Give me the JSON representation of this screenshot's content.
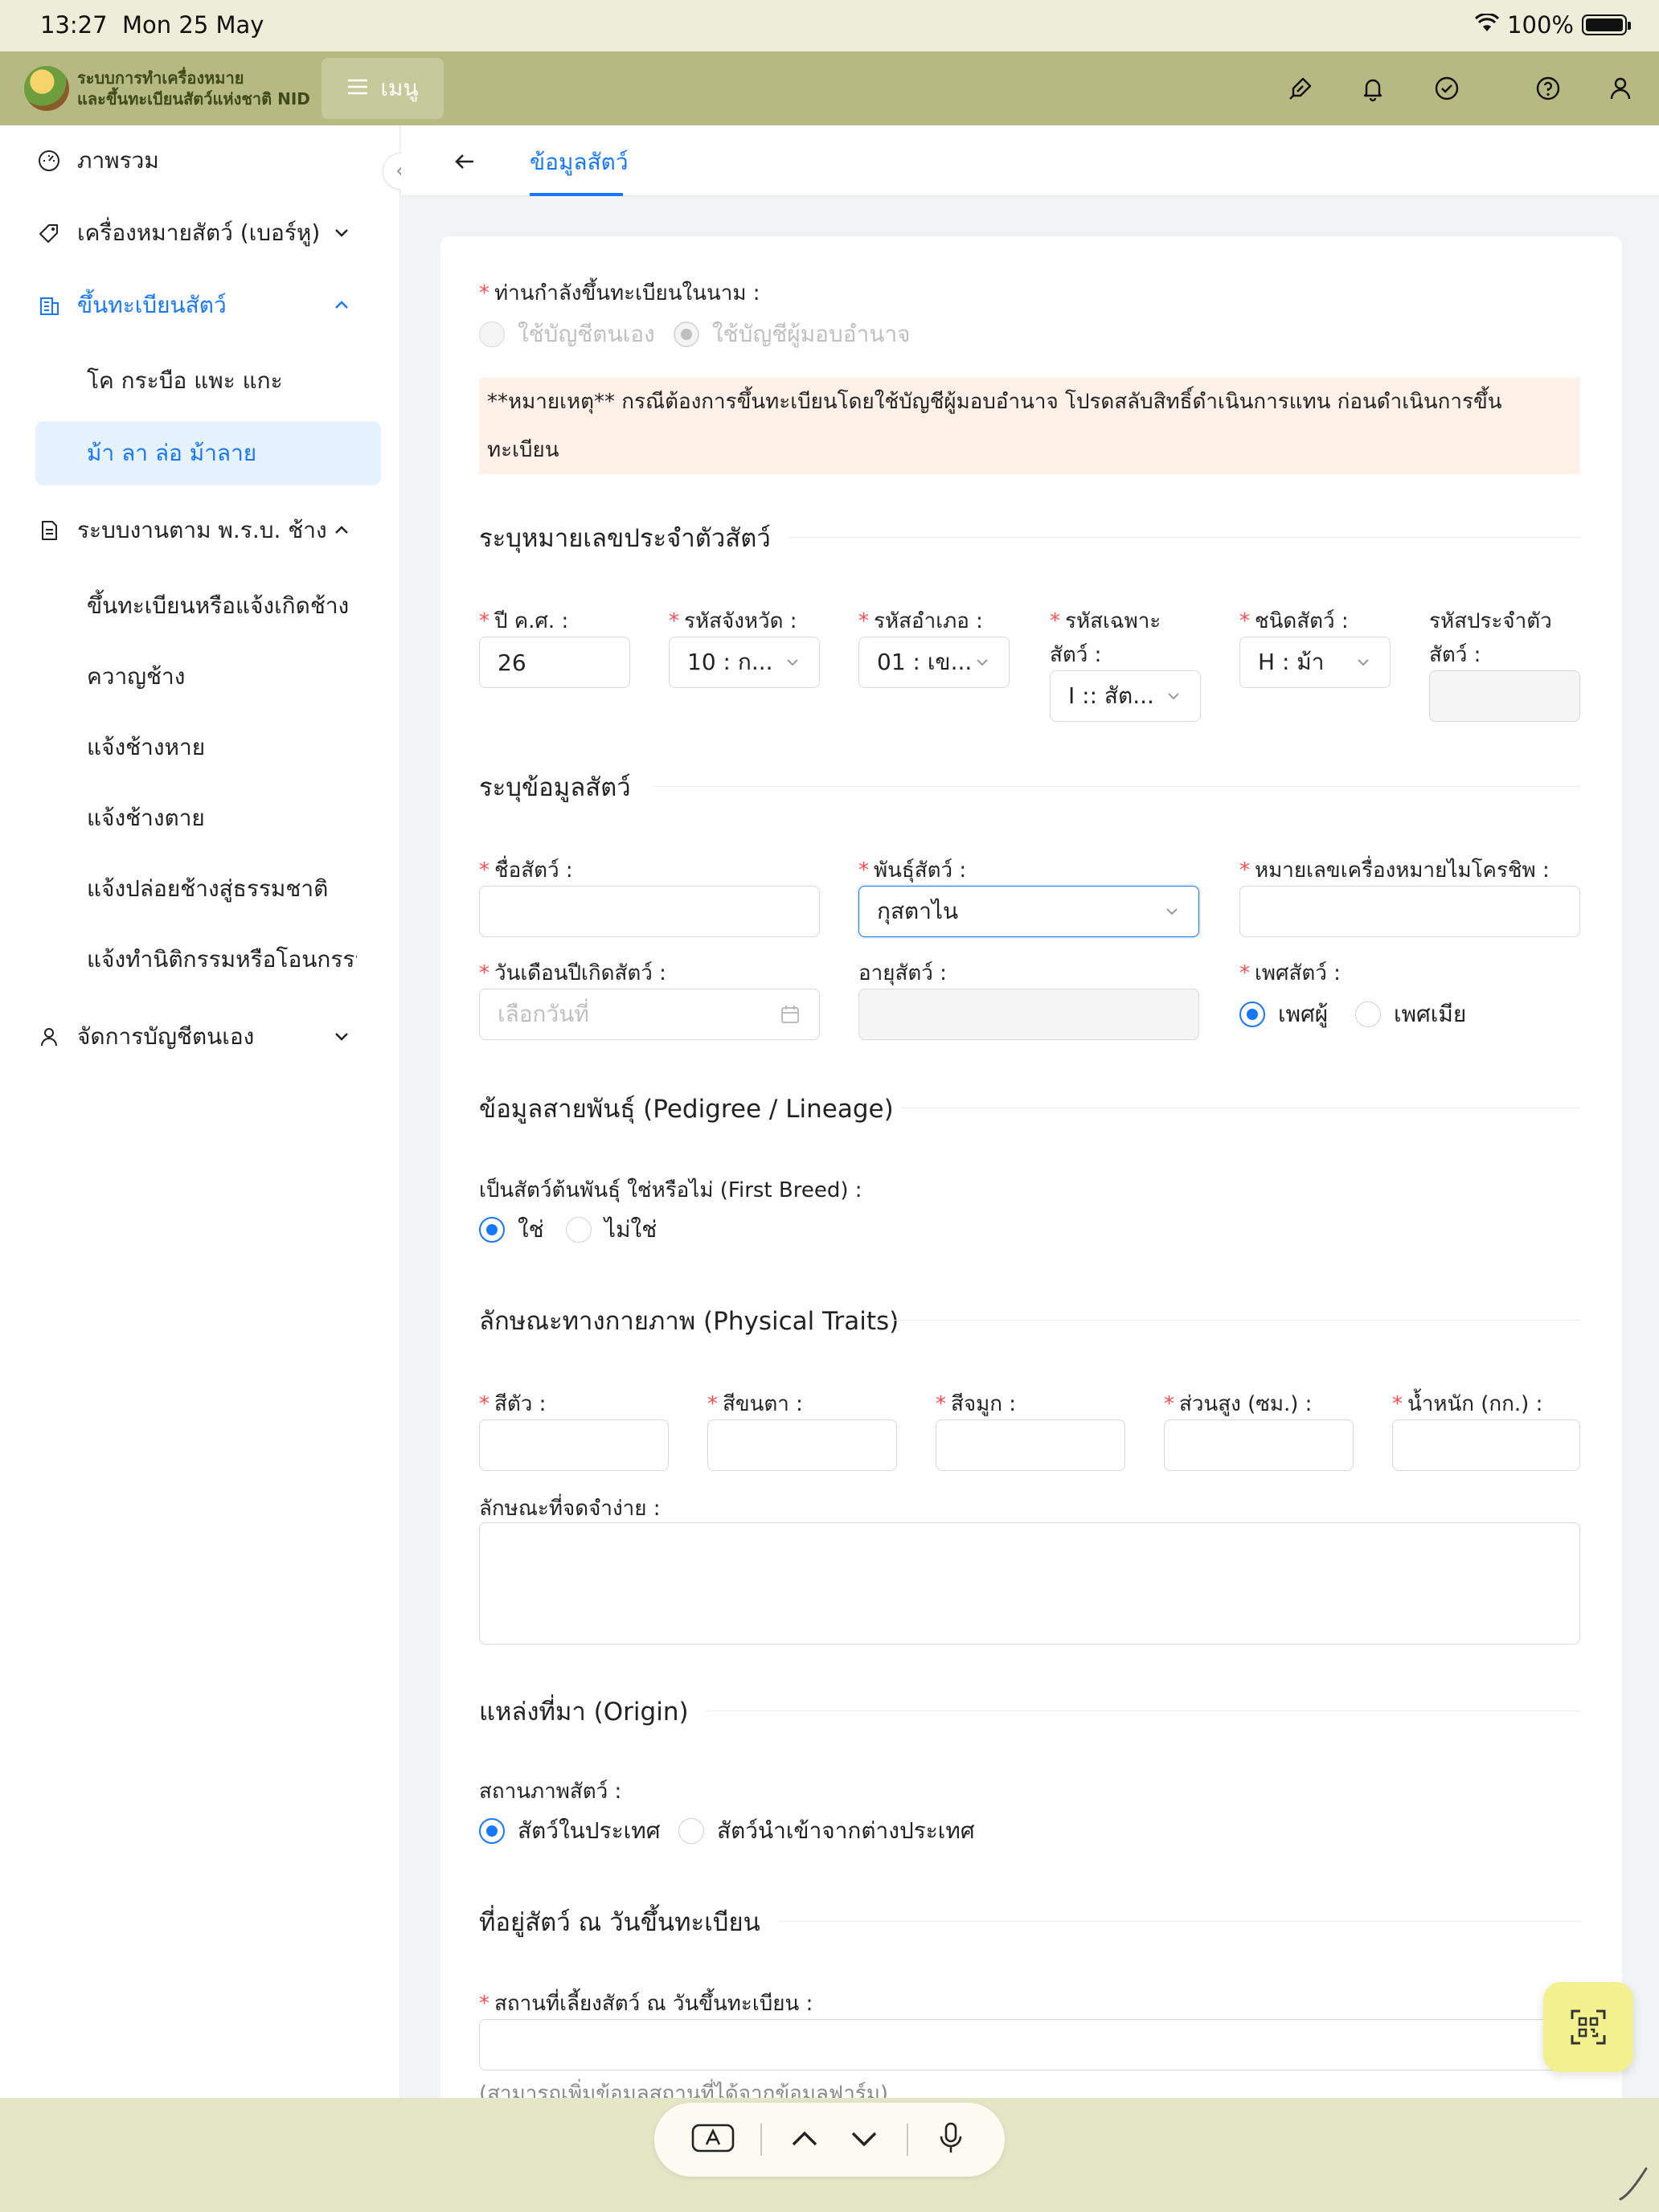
{
  "status": {
    "time": "13:27",
    "date": "Mon 25 May",
    "battery": "100%"
  },
  "header": {
    "brand_line1": "ระบบการทำเครื่องหมาย",
    "brand_line2": "และขึ้นทะเบียนสัตว์แห่งชาติ NID",
    "menu_label": "เมนู",
    "icons": [
      "clean-icon",
      "bell-icon",
      "check-circle-icon",
      "help-icon",
      "user-icon"
    ]
  },
  "sidebar": {
    "items": [
      {
        "label": "ภาพรวม",
        "icon": "dashboard-icon"
      },
      {
        "label": "เครื่องหมายสัตว์ (เบอร์หู)",
        "icon": "tag-icon"
      },
      {
        "label": "ขึ้นทะเบียนสัตว์",
        "icon": "building-icon"
      },
      {
        "label": "ระบบงานตาม พ.ร.บ. ช้าง",
        "icon": "document-icon"
      },
      {
        "label": "จัดการบัญชีตนเอง",
        "icon": "user-icon"
      }
    ],
    "register_sub": [
      "โค กระบือ แพะ แกะ",
      "ม้า ลา ล่อ ม้าลาย"
    ],
    "elephant_sub": [
      "ขึ้นทะเบียนหรือแจ้งเกิดช้าง",
      "ควาญช้าง",
      "แจ้งช้างหาย",
      "แจ้งช้างตาย",
      "แจ้งปล่อยช้างสู่ธรรมชาติ",
      "แจ้งทำนิติกรรมหรือโอนกรรม:"
    ]
  },
  "tab": {
    "label": "ข้อมูลสัตว์"
  },
  "form": {
    "register_as_label": "ท่านกำลังขึ้นทะเบียนในนาม :",
    "register_as_options": [
      "ใช้บัญชีตนเอง",
      "ใช้บัญชีผู้มอบอำนาจ"
    ],
    "register_as_selected": 1,
    "note_line1": "**หมายเหตุ** กรณีต้องการขึ้นทะเบียนโดยใช้บัญชีผู้มอบอำนาจ โปรดสลับสิทธิ์ดำเนินการแทน ก่อนดำเนินการขึ้น",
    "note_line2": "ทะเบียน",
    "section_id": "ระบุหมายเลขประจำตัวสัตว์",
    "year_label": "ปี ค.ศ. :",
    "year_value": "26",
    "province_label": "รหัสจังหวัด :",
    "province_value": "10 : ก...",
    "district_label": "รหัสอำเภอ :",
    "district_value": "01 : เข...",
    "specific_label_1": "รหัสเฉพาะ",
    "specific_label_2": "สัตว์ :",
    "specific_value": "I :: สัต...",
    "species_label": "ชนิดสัตว์ :",
    "species_value": "H : ม้า",
    "animal_id_label_1": "รหัสประจำตัว",
    "animal_id_label_2": "สัตว์ :",
    "section_info": "ระบุข้อมูลสัตว์",
    "name_label": "ชื่อสัตว์ :",
    "breed_label": "พันธุ์สัตว์ :",
    "breed_value": "กุสตาไน",
    "microchip_label": "หมายเลขเครื่องหมายไมโครชิพ :",
    "birthdate_label": "วันเดือนปีเกิดสัตว์ :",
    "birthdate_placeholder": "เลือกวันที่",
    "age_label": "อายุสัตว์ :",
    "sex_label": "เพศสัตว์ :",
    "sex_options": [
      "เพศผู้",
      "เพศเมีย"
    ],
    "sex_selected": 0,
    "section_pedigree": "ข้อมูลสายพันธุ์ (Pedigree / Lineage)",
    "first_breed_label": "เป็นสัตว์ต้นพันธุ์ ใช่หรือไม่ (First Breed) :",
    "first_breed_options": [
      "ใช่",
      "ไม่ใช่"
    ],
    "first_breed_selected": 0,
    "section_traits": "ลักษณะทางกายภาพ (Physical Traits)",
    "body_color_label": "สีตัว :",
    "eye_color_label": "สีขนตา :",
    "nose_color_label": "สีจมูก :",
    "height_label": "ส่วนสูง (ซม.) :",
    "weight_label": "น้ำหนัก (กก.) :",
    "marks_label": "ลักษณะที่จดจำง่าย :",
    "section_origin": "แหล่งที่มา (Origin)",
    "status_label": "สถานภาพสัตว์ :",
    "status_options": [
      "สัตว์ในประเทศ",
      "สัตว์นำเข้าจากต่างประเทศ"
    ],
    "status_selected": 0,
    "section_address": "ที่อยู่สัตว์ ณ วันขึ้นทะเบียน",
    "place_label": "สถานที่เลี้ยงสัตว์ ณ วันขึ้นทะเบียน :",
    "place_hint": "(สามารถเพิ่มข้อมูลสถานที่ได้จากข้อมูลฟาร์ม)"
  },
  "keyboard_bar": {
    "icons": [
      "keyboard-a-icon",
      "chevron-up-icon",
      "chevron-down-icon",
      "microphone-icon"
    ]
  },
  "colors": {
    "primary": "#1677ff",
    "header": "#b6ba82",
    "required": "#ff4d4f",
    "note_bg": "#fff1e8"
  }
}
